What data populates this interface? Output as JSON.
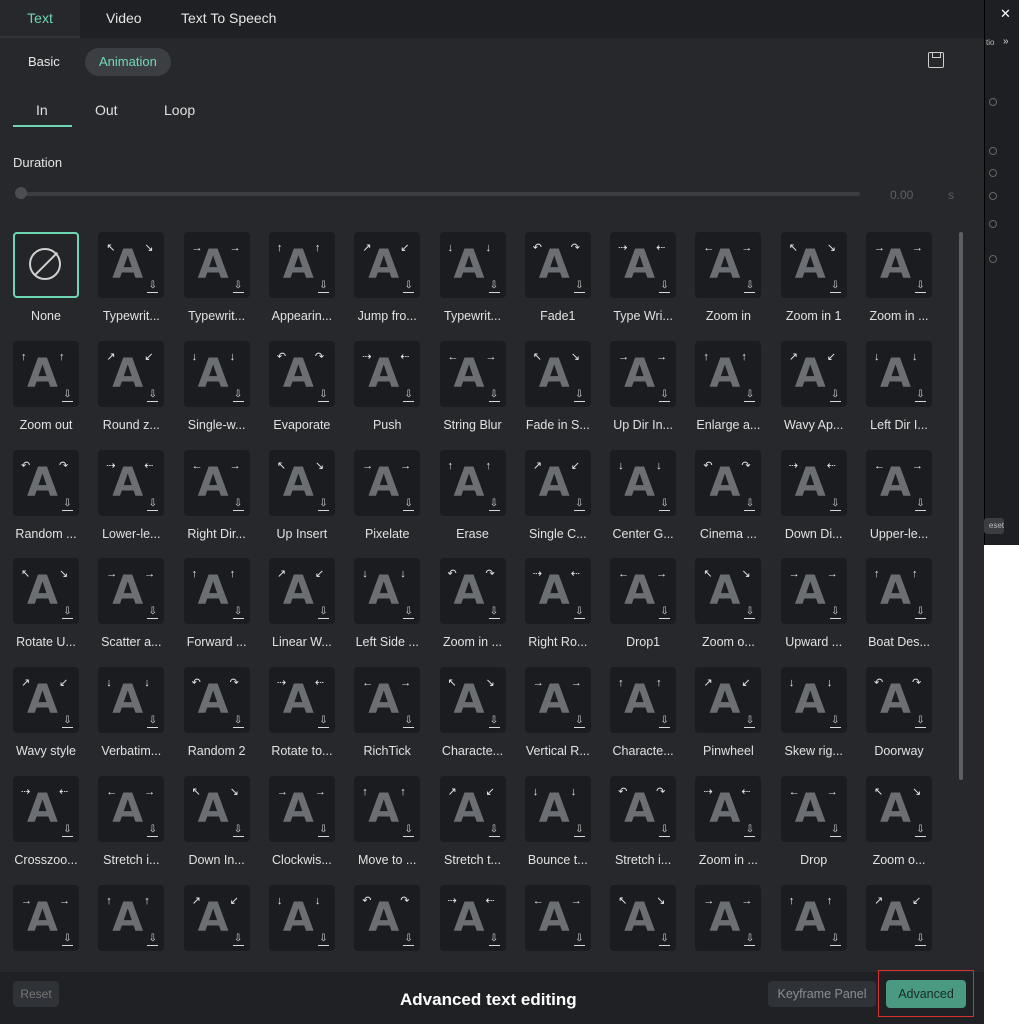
{
  "top_tabs": [
    "Text",
    "Video",
    "Text To Speech"
  ],
  "segments": [
    "Basic",
    "Animation"
  ],
  "sub_tabs": [
    "In",
    "Out",
    "Loop"
  ],
  "duration": {
    "label": "Duration",
    "value": "0.00",
    "unit": "s"
  },
  "side": {
    "close": "✕",
    "label": "tio",
    "chevron": "»",
    "reset": "eset"
  },
  "effects": [
    "None",
    "Typewrit...",
    "Typewrit...",
    "Appearin...",
    "Jump fro...",
    "Typewrit...",
    "Fade1",
    "Type Wri...",
    "Zoom in",
    "Zoom in 1",
    "Zoom in ...",
    "Zoom out",
    "Round z...",
    "Single-w...",
    "Evaporate",
    "Push",
    "String Blur",
    "Fade in S...",
    "Up Dir In...",
    "Enlarge a...",
    "Wavy Ap...",
    "Left Dir I...",
    "Random ...",
    "Lower-le...",
    "Right Dir...",
    "Up Insert",
    "Pixelate",
    "Erase",
    "Single C...",
    "Center G...",
    "Cinema ...",
    "Down Di...",
    "Upper-le...",
    "Rotate U...",
    "Scatter a...",
    "Forward ...",
    "Linear W...",
    "Left Side ...",
    "Zoom in ...",
    "Right Ro...",
    "Drop1",
    "Zoom o...",
    "Upward ...",
    "Boat Des...",
    "Wavy style",
    "Verbatim...",
    "Random 2",
    "Rotate to...",
    "RichTick",
    "Characte...",
    "Vertical R...",
    "Characte...",
    "Pinwheel",
    "Skew rig...",
    "Doorway",
    "Crosszoo...",
    "Stretch i...",
    "Down In...",
    "Clockwis...",
    "Move to ...",
    "Stretch t...",
    "Bounce t...",
    "Stretch i...",
    "Zoom in ...",
    "Drop",
    "Zoom o...",
    "",
    "",
    "",
    "",
    "",
    "",
    "",
    "",
    "",
    "",
    ""
  ],
  "bottom": {
    "reset": "Reset",
    "caption": "Advanced text editing",
    "keyframe": "Keyframe Panel",
    "advanced": "Advanced"
  }
}
